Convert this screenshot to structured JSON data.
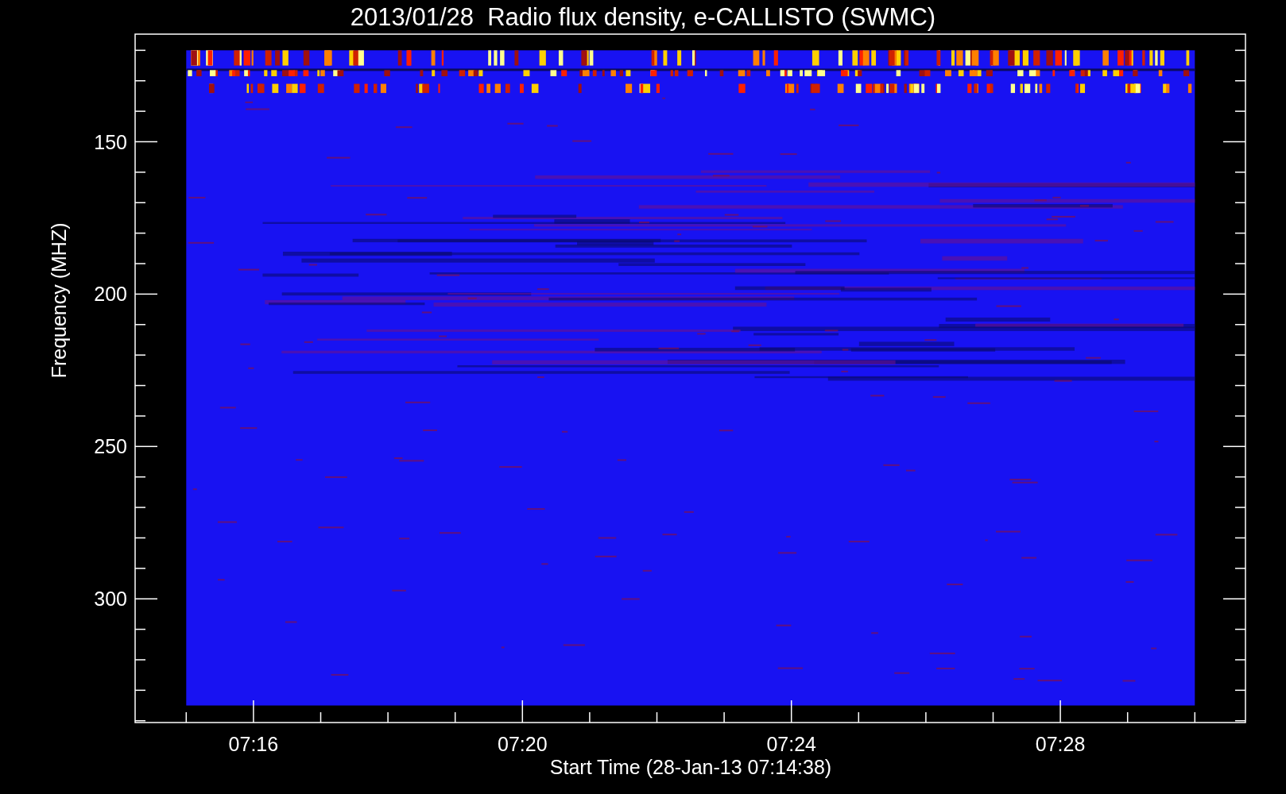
{
  "title": "2013/01/28  Radio flux density, e-CALLISTO (SWMC)",
  "y_axis": {
    "label": "Frequency (MHZ)",
    "tick_labels": [
      "150",
      "200",
      "250",
      "300"
    ]
  },
  "x_axis": {
    "label": "Start Time (28-Jan-13 07:14:38)",
    "tick_labels": [
      "07:16",
      "07:20",
      "07:24",
      "07:28"
    ]
  }
}
